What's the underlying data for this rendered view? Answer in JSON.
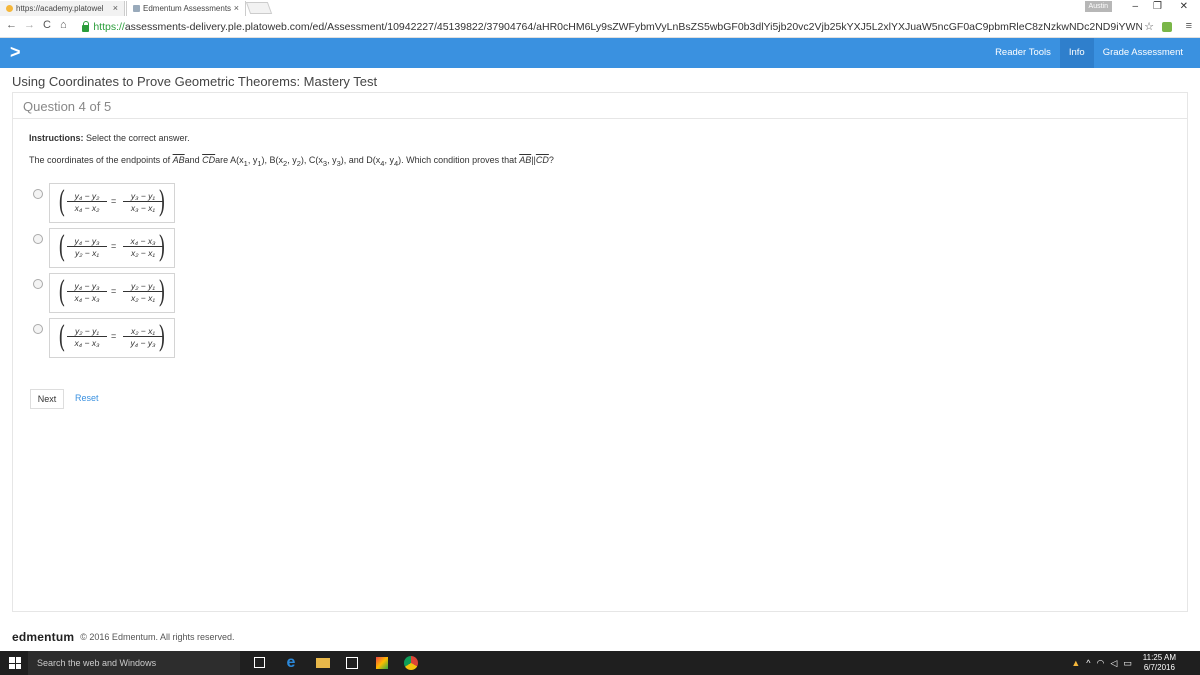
{
  "browser": {
    "tabs": [
      {
        "label": "https://academy.platowel",
        "close": "×"
      },
      {
        "label": "Edmentum Assessments",
        "close": "×"
      }
    ],
    "profile_label": "Austin",
    "minimize": "–",
    "restore": "❐",
    "close": "✕",
    "back": "←",
    "forward": "→",
    "reload": "C",
    "home": "⌂",
    "url_scheme": "https://",
    "url_rest": "assessments-delivery.ple.platoweb.com/ed/Assessment/10942227/45139822/37904764/aHR0cHM6Ly9sZWFybmVyLnBsZS5wbGF0b3dlYi5jb20vc2Vjb25kYXJ5L2xlYXJuaW5ncGF0aC9pbmRleC8zNzkwNDc2ND9iYWNrQ29udHJvbGVyPU",
    "star": "☆",
    "menu": "≡"
  },
  "app": {
    "chevron": ">",
    "links": [
      {
        "label": "Reader Tools",
        "active": false
      },
      {
        "label": "Info",
        "active": true
      },
      {
        "label": "Grade Assessment",
        "active": false
      }
    ]
  },
  "page_title": "Using Coordinates to Prove Geometric Theorems: Mastery Test",
  "question_number": "Question 4 of 5",
  "instructions_label": "Instructions:",
  "instructions_text": " Select the correct answer.",
  "question": {
    "p1": "The coordinates of the endpoints of ",
    "seg1": "AB",
    "p2": "and ",
    "seg2": "CD",
    "p3": "are A(x",
    "p3s": "1",
    "p4": ", y",
    "p4s": "1",
    "p5": "), B(x",
    "p5s": "2",
    "p6": ", y",
    "p6s": "2",
    "p7": "), C(x",
    "p7s": "3",
    "p8": ", y",
    "p8s": "3",
    "p9": "), and D(x",
    "p9s": "4",
    "p10": ", y",
    "p10s": "4",
    "p11": "). Which condition proves that ",
    "seg3": "AB",
    "par": "||",
    "seg4": "CD",
    "q": "?"
  },
  "options": [
    {
      "n1": "y₄ − y₂",
      "d1": "x₄ − x₂",
      "n2": "y₃ − y₁",
      "d2": "x₃ − x₁",
      "eq": "="
    },
    {
      "n1": "y₄ − y₃",
      "d1": "y₂ − x₁",
      "n2": "x₄ − x₃",
      "d2": "x₂ − x₁",
      "eq": "="
    },
    {
      "n1": "y₄ − y₃",
      "d1": "x₄ − x₃",
      "n2": "y₂ − y₁",
      "d2": "x₂ − x₁",
      "eq": "="
    },
    {
      "n1": "y₂ − y₁",
      "d1": "x₄ − x₃",
      "n2": "x₂ − x₁",
      "d2": "y₄ − y₃",
      "eq": "="
    }
  ],
  "paren_left": "(",
  "paren_right": ")",
  "next_label": "Next",
  "reset_label": "Reset",
  "footer": {
    "brand": "edmentum",
    "copyright": "© 2016 Edmentum. All rights reserved."
  },
  "taskbar": {
    "search_placeholder": "Search the web and Windows",
    "time": "11:25 AM",
    "date": "6/7/2016"
  }
}
